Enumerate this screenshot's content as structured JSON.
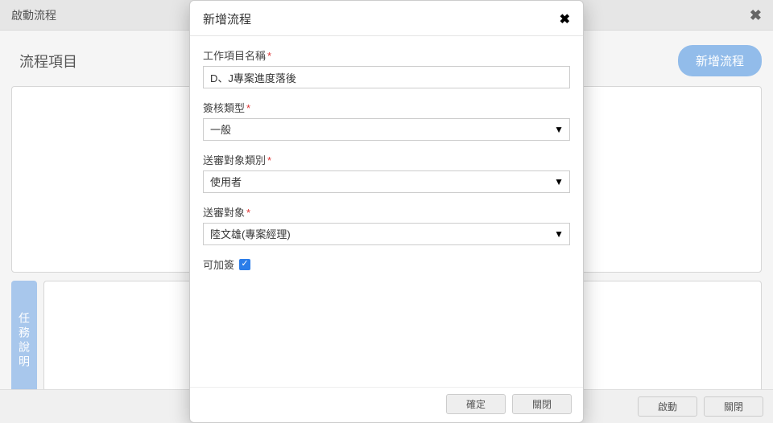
{
  "bg": {
    "header_title": "啟動流程",
    "section_title": "流程項目",
    "new_flow_btn": "新增流程",
    "task_tab": "任務說明",
    "footer_start": "啟動",
    "footer_close": "關閉"
  },
  "modal": {
    "title": "新增流程",
    "close_glyph": "✖",
    "fields": {
      "name_label": "工作項目名稱",
      "name_value": "D、J專案進度落後",
      "type_label": "簽核類型",
      "type_value": "一般",
      "recv_cat_label": "送審對象類別",
      "recv_cat_value": "使用者",
      "recv_label": "送審對象",
      "recv_value": "陸文雄(專案經理)",
      "cosign_label": "可加簽",
      "cosign_checked": true
    },
    "footer_ok": "確定",
    "footer_close": "關閉"
  }
}
